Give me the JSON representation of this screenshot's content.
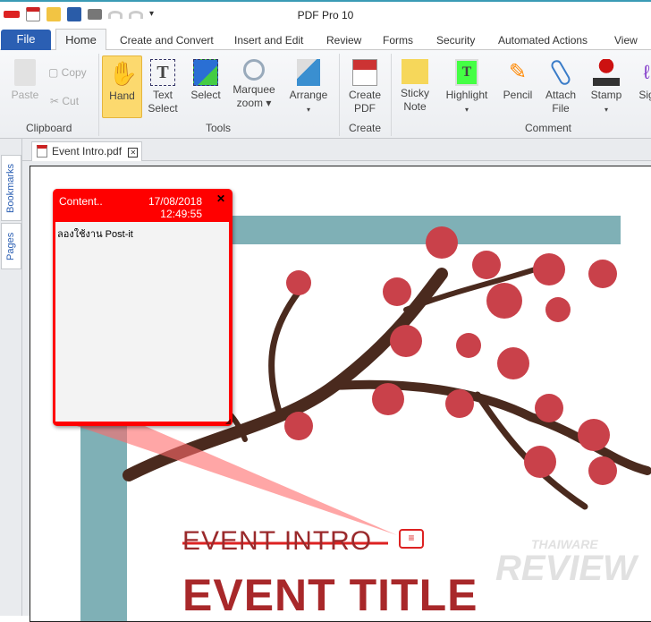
{
  "app": {
    "title": "PDF Pro 10"
  },
  "quick_access": [
    "app-logo-icon",
    "new-pdf-icon",
    "open-folder-icon",
    "save-icon",
    "print-icon",
    "undo-icon",
    "redo-icon",
    "customize-icon"
  ],
  "tabs": {
    "file": "File",
    "home": "Home",
    "others": [
      "Create and Convert",
      "Insert and Edit",
      "Review",
      "Forms",
      "Security",
      "Automated Actions",
      "View"
    ]
  },
  "ribbon": {
    "clipboard": {
      "paste": "Paste",
      "copy": "Copy",
      "cut": "Cut",
      "group": "Clipboard"
    },
    "tools": {
      "hand": "Hand",
      "text_select_1": "Text",
      "text_select_2": "Select",
      "select": "Select",
      "marquee_1": "Marquee",
      "marquee_2": "zoom ▾",
      "arrange": "Arrange",
      "arrange_arrow": "▾",
      "group": "Tools"
    },
    "create": {
      "create_pdf_1": "Create",
      "create_pdf_2": "PDF",
      "group": "Create"
    },
    "comment": {
      "sticky_1": "Sticky",
      "sticky_2": "Note",
      "highlight": "Highlight",
      "highlight_arrow": "▾",
      "pencil": "Pencil",
      "attach_1": "Attach",
      "attach_2": "File",
      "stamp": "Stamp",
      "stamp_arrow": "▾",
      "sign": "Sig",
      "group": "Comment"
    }
  },
  "sidebar": {
    "bookmarks": "Bookmarks",
    "pages": "Pages"
  },
  "document_tab": {
    "name": "Event Intro.pdf",
    "close": "✕"
  },
  "sticky_note": {
    "author": "Content..",
    "date": "17/08/2018",
    "time": "12:49:55",
    "close": "✕",
    "text": "ลองใช้งาน Post-it"
  },
  "page": {
    "event_intro": "EVENT INTRO",
    "event_title": "EVENT TITLE",
    "watermark_1": "THAIWARE",
    "watermark_2": "REVIEW"
  },
  "colors": {
    "accent": "#2b5fb3",
    "note": "#ff0000",
    "title_red": "#a8282a",
    "frame": "#7fb0b6"
  }
}
